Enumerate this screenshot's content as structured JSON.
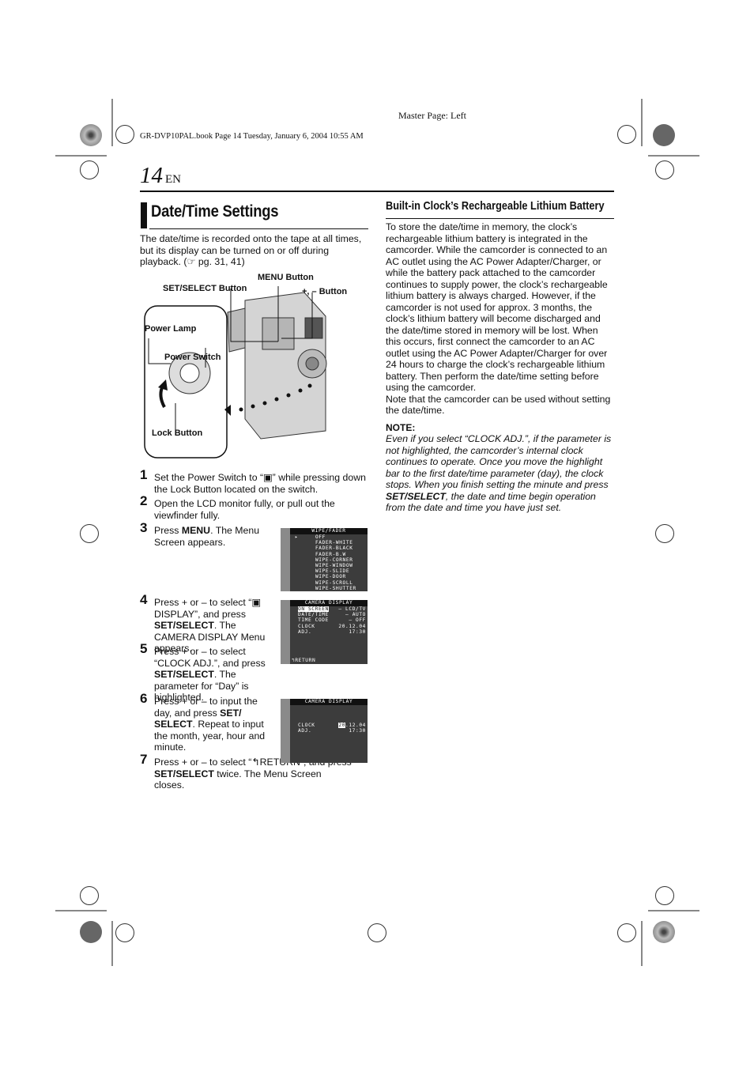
{
  "header": {
    "master_page": "Master Page: Left",
    "book_line": "GR-DVP10PAL.book  Page 14  Tuesday, January 6, 2004  10:55 AM",
    "page_number": "14",
    "language": "EN"
  },
  "left": {
    "title": "Date/Time Settings",
    "intro": "The date/time is recorded onto the tape at all times, but its display can be turned on or off during playback. (☞ pg. 31, 41)",
    "diagram_labels": {
      "menu_button": "MENU Button",
      "set_select_button": "SET/SELECT Button",
      "plus_minus_button": "+, –  Button",
      "power_lamp": "Power Lamp",
      "power_switch": "Power Switch",
      "lock_button": "Lock Button"
    },
    "steps": [
      {
        "num": "1",
        "parts": [
          "Set the Power Switch to “▣” while pressing down the Lock Button located on the switch."
        ]
      },
      {
        "num": "2",
        "parts": [
          "Open the LCD monitor fully, or pull out the viewfinder fully."
        ]
      },
      {
        "num": "3",
        "pre": "Press ",
        "bold": "MENU",
        "post": ". The Menu Screen appears."
      },
      {
        "num": "4",
        "pre": "Press + or – to select “▣ DISPLAY”, and press ",
        "bold": "SET/SELECT",
        "post": ". The CAMERA DISPLAY Menu appears."
      },
      {
        "num": "5",
        "pre": "Press + or – to select “CLOCK ADJ.”, and press ",
        "bold": "SET/SELECT",
        "post": ". The parameter for “Day” is highlighted."
      },
      {
        "num": "6",
        "pre": "Press + or – to input the day, and press ",
        "bold": "SET/ SELECT",
        "post": ". Repeat to input the month, year, hour and minute."
      },
      {
        "num": "7",
        "pre": "Press + or – to select “↰RETURN”, and press ",
        "bold": "SET/SELECT",
        "post": " twice. The Menu Screen closes."
      }
    ],
    "screens": {
      "wipe_fader": {
        "title": "WIPE/FADER",
        "rows": [
          "▸     OFF",
          "      FADER-WHITE",
          "      FADER-BLACK",
          "      FADER-B.W",
          "      WIPE-CORNER",
          "      WIPE-WINDOW",
          "      WIPE-SLIDE",
          "      WIPE-DOOR",
          "      WIPE-SCROLL",
          "      WIPE-SHUTTER"
        ]
      },
      "camera_display": {
        "title": "CAMERA DISPLAY",
        "rows": [
          {
            "label": "ON SCREEN",
            "value": "– LCD/TV",
            "highlighted": true
          },
          {
            "label": "DATE/TIME",
            "value": "– AUTO"
          },
          {
            "label": "TIME CODE",
            "value": "– OFF"
          },
          {
            "label": "CLOCK",
            "value": "20.12.04"
          },
          {
            "label": "ADJ.",
            "value": "17:30"
          }
        ],
        "footer": "↰RETURN"
      },
      "clock_adj": {
        "title": "CAMERA DISPLAY",
        "clock_label": "CLOCK",
        "adj_label": "ADJ.",
        "day": "20",
        "date_rest": ".12.04",
        "time": "17:30"
      }
    }
  },
  "right": {
    "title": "Built-in Clock’s Rechargeable Lithium Battery",
    "body": "To store the date/time in memory, the clock’s rechargeable lithium battery is integrated in the camcorder. While the camcorder is connected to an AC outlet using the AC Power Adapter/Charger, or while the battery pack attached to the camcorder continues to supply power, the clock’s rechargeable lithium battery is always charged. However, if the camcorder is not used for approx. 3 months, the clock’s lithium battery will become discharged and the date/time stored in memory will be lost. When this occurs, first connect the camcorder to an AC outlet using the AC Power Adapter/Charger for over 24 hours to charge the clock’s rechargeable lithium battery. Then perform the date/time setting before using the camcorder.",
    "body2": "Note that the camcorder can be used without setting the date/time.",
    "note_heading": "NOTE:",
    "note_pre": "Even if you select “CLOCK ADJ.”, if the parameter is not highlighted, the camcorder’s internal clock continues to operate. Once you move the highlight bar to the first date/time parameter (day), the clock stops. When you finish setting the minute and press ",
    "note_bold": "SET/SELECT",
    "note_post": ", the date and time begin operation from the date and time you have just set."
  }
}
